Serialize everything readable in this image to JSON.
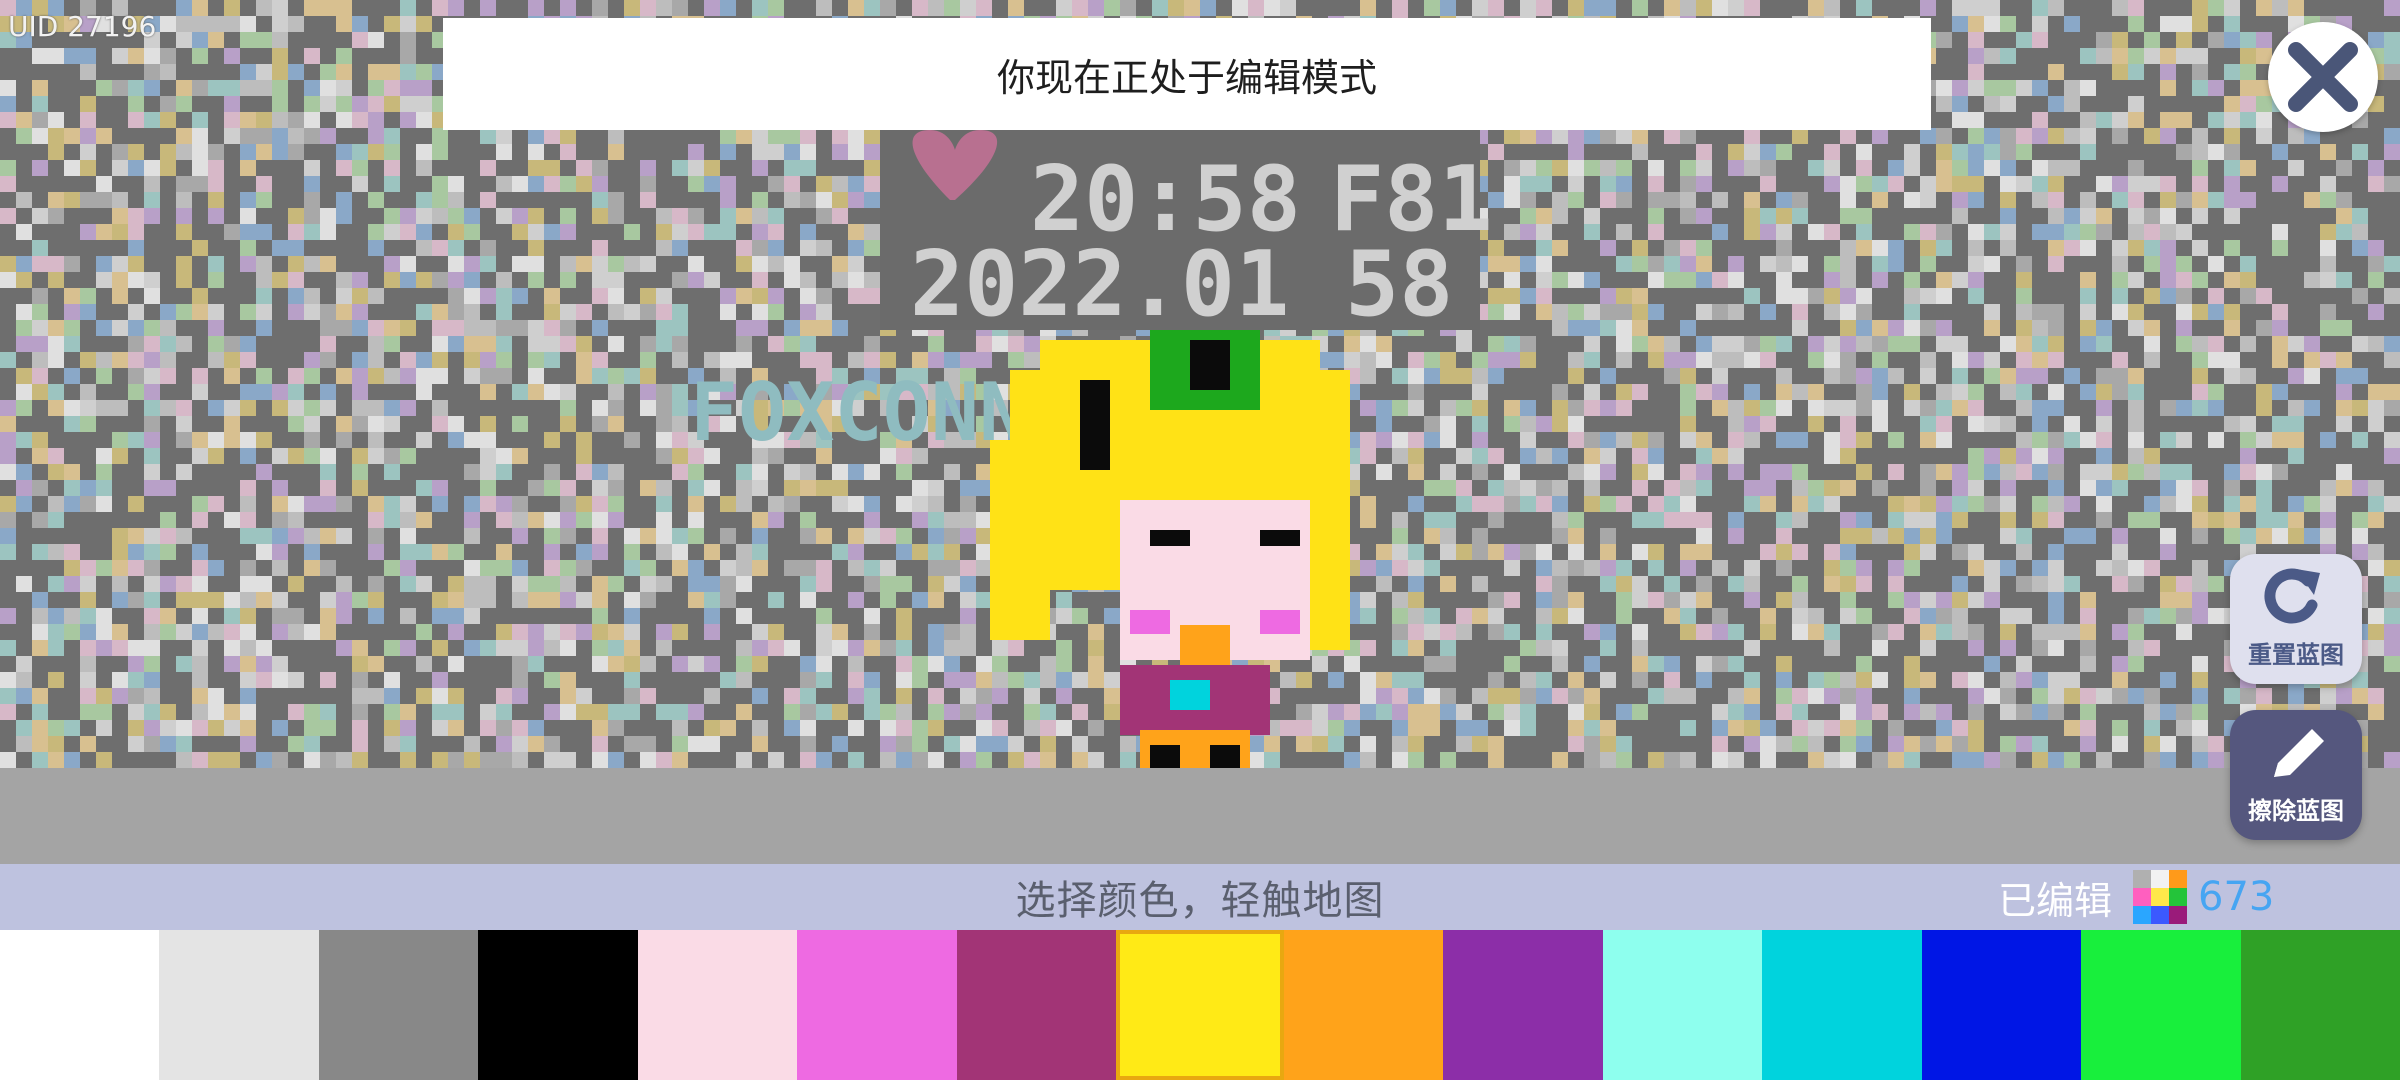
{
  "uid_label": "UID 27196",
  "banner": {
    "text": "你现在正处于编辑模式"
  },
  "buttons": {
    "close_icon": "close-icon",
    "reset_blueprint": {
      "label": "重置蓝图",
      "icon": "refresh-icon"
    },
    "erase_blueprint": {
      "label": "擦除蓝图",
      "icon": "pencil-icon"
    }
  },
  "info_bar": {
    "instruction": "选择颜色，轻触地图",
    "edited_label": "已编辑",
    "edited_count": "673",
    "edited_icon": "pixels-icon"
  },
  "canvas": {
    "clock_text": "20:58",
    "clock_suffix": "F81",
    "date_text": "2022.01",
    "date_suffix": "58",
    "sign_text": "FOXCONN"
  },
  "palette": {
    "selected_index": 7,
    "colors": [
      "#ffffff",
      "#e4e4e4",
      "#888888",
      "#000000",
      "#fadbe6",
      "#ee6ae2",
      "#a23476",
      "#ffea16",
      "#ffa31a",
      "#8c2ea8",
      "#8effee",
      "#00d3dd",
      "#0016e5",
      "#18ef3c",
      "#2fa126"
    ]
  },
  "colors": {
    "accent_blue": "#46a5f2",
    "selection_border": "#e8a810"
  }
}
